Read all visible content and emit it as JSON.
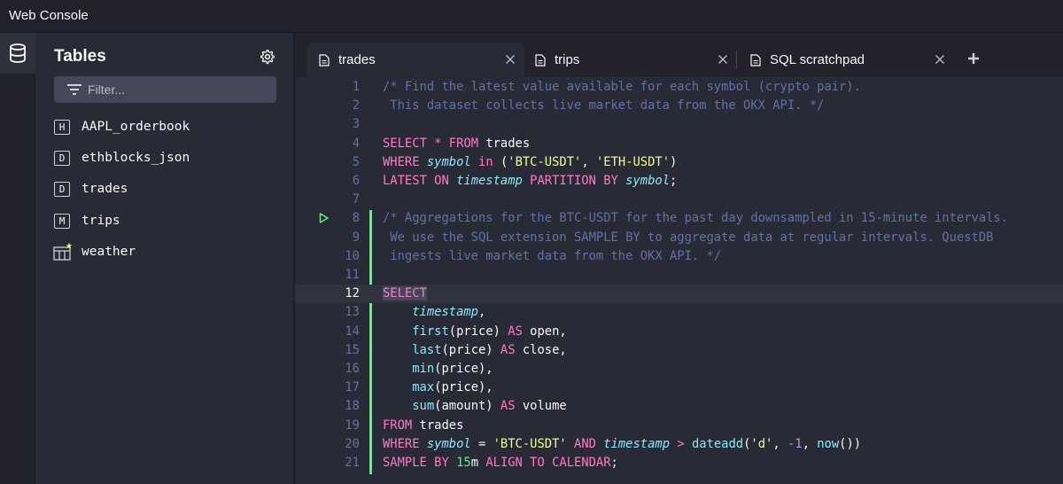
{
  "app": {
    "title": "Web Console"
  },
  "sidebar": {
    "heading": "Tables",
    "filter_placeholder": "Filter...",
    "tables": [
      {
        "badge": "H",
        "name": "AAPL_orderbook"
      },
      {
        "badge": "D",
        "name": "ethblocks_json"
      },
      {
        "badge": "D",
        "name": "trades"
      },
      {
        "badge": "M",
        "name": "trips"
      },
      {
        "badge": "",
        "name": "weather",
        "icon": "table-grid-star-icon"
      }
    ]
  },
  "tabs": [
    {
      "label": "trades",
      "active": true
    },
    {
      "label": "trips",
      "active": false
    },
    {
      "label": "SQL scratchpad",
      "active": false
    }
  ],
  "editor": {
    "current_line": 12,
    "run_marker_line": 8,
    "lines": [
      {
        "n": "1",
        "tokens": [
          [
            "c",
            "/* Find the latest value available for each symbol (crypto pair)."
          ]
        ]
      },
      {
        "n": "2",
        "tokens": [
          [
            "c",
            " This dataset collects live market data from the OKX API. */"
          ]
        ]
      },
      {
        "n": "3",
        "tokens": []
      },
      {
        "n": "4",
        "tokens": [
          [
            "k",
            "SELECT"
          ],
          [
            "p",
            " "
          ],
          [
            "o",
            "*"
          ],
          [
            "p",
            " "
          ],
          [
            "k",
            "FROM"
          ],
          [
            "p",
            " trades"
          ]
        ]
      },
      {
        "n": "5",
        "tokens": [
          [
            "k",
            "WHERE"
          ],
          [
            "p",
            " "
          ],
          [
            "i",
            "symbol"
          ],
          [
            "p",
            " "
          ],
          [
            "k",
            "in"
          ],
          [
            "p",
            " ("
          ],
          [
            "s",
            "'BTC-USDT'"
          ],
          [
            "p",
            ", "
          ],
          [
            "s",
            "'ETH-USDT'"
          ],
          [
            "p",
            ")"
          ]
        ]
      },
      {
        "n": "6",
        "tokens": [
          [
            "k",
            "LATEST ON"
          ],
          [
            "p",
            " "
          ],
          [
            "i",
            "timestamp"
          ],
          [
            "p",
            " "
          ],
          [
            "k",
            "PARTITION BY"
          ],
          [
            "p",
            " "
          ],
          [
            "i",
            "symbol"
          ],
          [
            "p",
            ";"
          ]
        ]
      },
      {
        "n": "7",
        "tokens": []
      },
      {
        "n": "8",
        "tokens": [
          [
            "c",
            "/* Aggregations for the BTC-USDT for the past day downsampled in 15-minute intervals."
          ]
        ]
      },
      {
        "n": "9",
        "tokens": [
          [
            "c",
            " We use the SQL extension SAMPLE BY to aggregate data at regular intervals. QuestDB"
          ]
        ]
      },
      {
        "n": "10",
        "tokens": [
          [
            "c",
            " ingests live market data from the OKX API. */"
          ]
        ]
      },
      {
        "n": "11",
        "tokens": []
      },
      {
        "n": "12",
        "tokens": [
          [
            "kh",
            "SELECT"
          ]
        ]
      },
      {
        "n": "13",
        "tokens": [
          [
            "p",
            "    "
          ],
          [
            "i",
            "timestamp"
          ],
          [
            "p",
            ","
          ]
        ]
      },
      {
        "n": "14",
        "tokens": [
          [
            "p",
            "    "
          ],
          [
            "f",
            "first"
          ],
          [
            "p",
            "(price) "
          ],
          [
            "k",
            "AS"
          ],
          [
            "p",
            " open,"
          ]
        ]
      },
      {
        "n": "15",
        "tokens": [
          [
            "p",
            "    "
          ],
          [
            "f",
            "last"
          ],
          [
            "p",
            "(price) "
          ],
          [
            "k",
            "AS"
          ],
          [
            "p",
            " close,"
          ]
        ]
      },
      {
        "n": "16",
        "tokens": [
          [
            "p",
            "    "
          ],
          [
            "f",
            "min"
          ],
          [
            "p",
            "(price),"
          ]
        ]
      },
      {
        "n": "17",
        "tokens": [
          [
            "p",
            "    "
          ],
          [
            "f",
            "max"
          ],
          [
            "p",
            "(price),"
          ]
        ]
      },
      {
        "n": "18",
        "tokens": [
          [
            "p",
            "    "
          ],
          [
            "f",
            "sum"
          ],
          [
            "p",
            "(amount) "
          ],
          [
            "k",
            "AS"
          ],
          [
            "p",
            " volume"
          ]
        ]
      },
      {
        "n": "19",
        "tokens": [
          [
            "k",
            "FROM"
          ],
          [
            "p",
            " trades"
          ]
        ]
      },
      {
        "n": "20",
        "tokens": [
          [
            "k",
            "WHERE"
          ],
          [
            "p",
            " "
          ],
          [
            "i",
            "symbol"
          ],
          [
            "p",
            " = "
          ],
          [
            "s",
            "'BTC-USDT'"
          ],
          [
            "p",
            " "
          ],
          [
            "k",
            "AND"
          ],
          [
            "p",
            " "
          ],
          [
            "i",
            "timestamp"
          ],
          [
            "p",
            " "
          ],
          [
            "o",
            ">"
          ],
          [
            "p",
            " "
          ],
          [
            "f",
            "dateadd"
          ],
          [
            "p",
            "("
          ],
          [
            "s",
            "'d'"
          ],
          [
            "p",
            ", "
          ],
          [
            "n",
            "-1"
          ],
          [
            "p",
            ", "
          ],
          [
            "f",
            "now"
          ],
          [
            "p",
            "())"
          ]
        ]
      },
      {
        "n": "21",
        "tokens": [
          [
            "k",
            "SAMPLE BY"
          ],
          [
            "p",
            " "
          ],
          [
            "g",
            "15"
          ],
          [
            "p",
            "m "
          ],
          [
            "k",
            "ALIGN TO CALENDAR"
          ],
          [
            "p",
            ";"
          ]
        ]
      }
    ]
  }
}
